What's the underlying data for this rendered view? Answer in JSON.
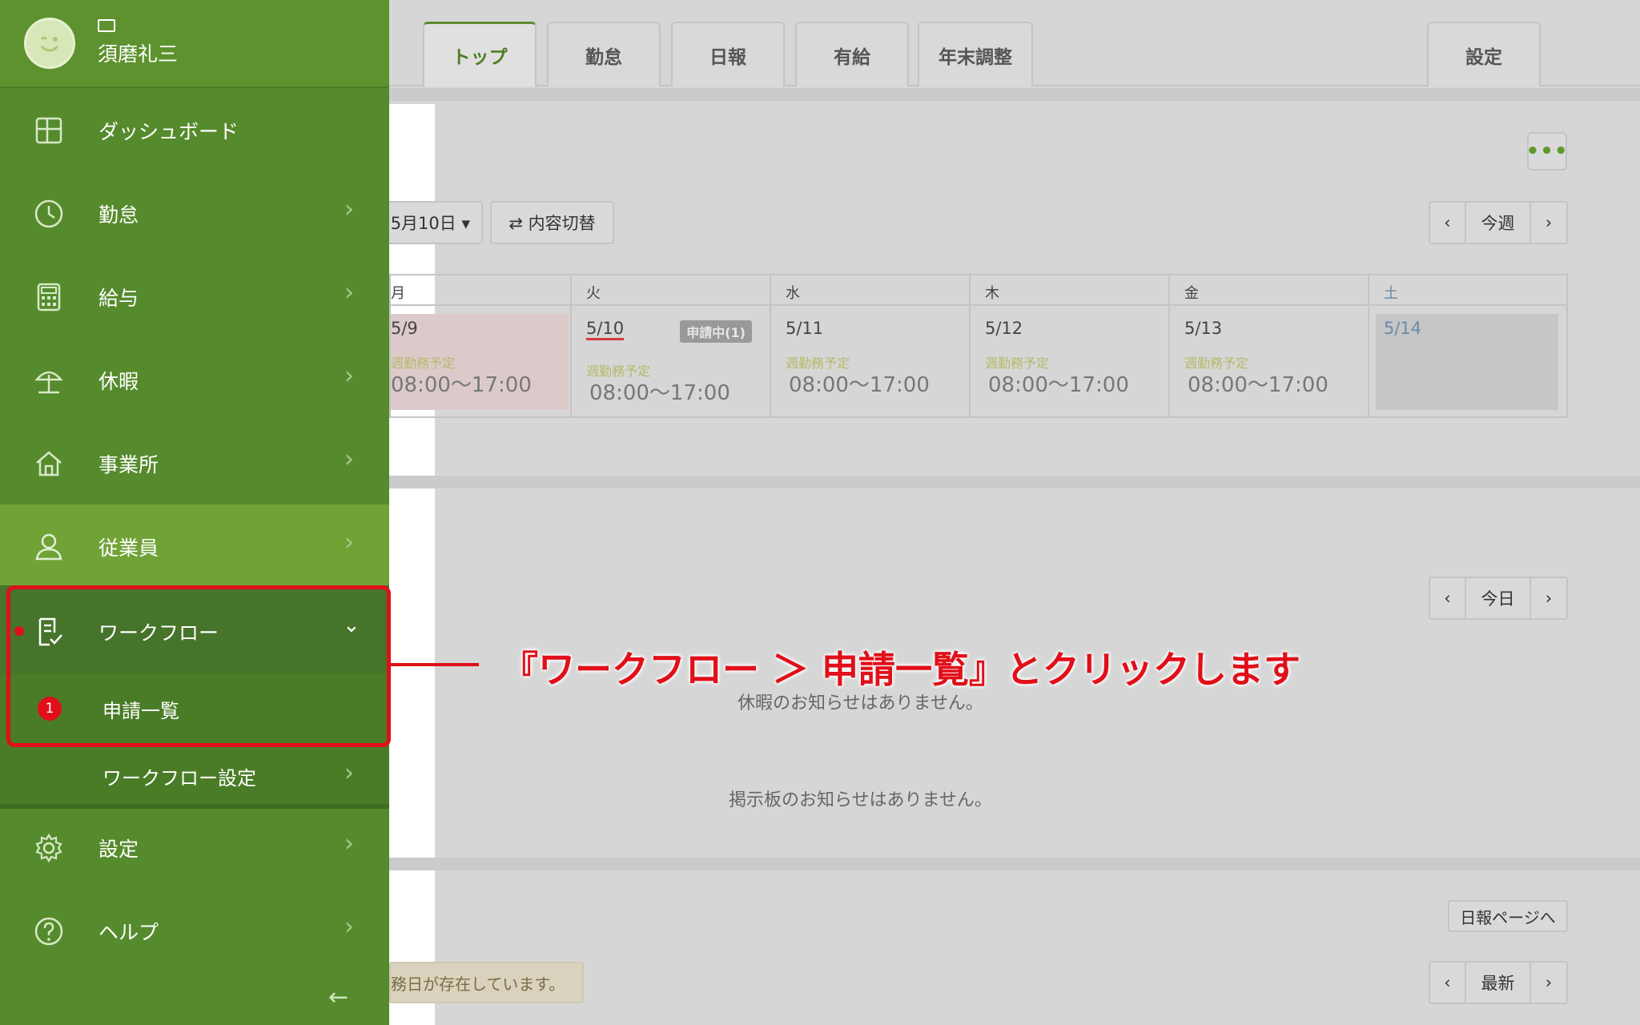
{
  "user": {
    "name": "須磨礼三"
  },
  "sidebar": {
    "items": [
      {
        "key": "dashboard",
        "label": "ダッシュボード"
      },
      {
        "key": "attendance",
        "label": "勤怠"
      },
      {
        "key": "salary",
        "label": "給与"
      },
      {
        "key": "leave",
        "label": "休暇"
      },
      {
        "key": "office",
        "label": "事業所"
      },
      {
        "key": "employee",
        "label": "従業員"
      },
      {
        "key": "workflow",
        "label": "ワークフロー"
      },
      {
        "key": "settings",
        "label": "設定"
      },
      {
        "key": "help",
        "label": "ヘルプ"
      }
    ],
    "workflow_sub": [
      {
        "label": "申請一覧",
        "badge": "1"
      },
      {
        "label": "ワークフロー設定"
      }
    ],
    "collapse": "←"
  },
  "tabs": [
    {
      "label": "トップ",
      "active": true
    },
    {
      "label": "勤怠"
    },
    {
      "label": "日報"
    },
    {
      "label": "有給"
    },
    {
      "label": "年末調整"
    },
    {
      "label": "設定"
    }
  ],
  "toolbar": {
    "more": "•••",
    "date_select": "5月10日 ▾",
    "switch_content": "⇄ 内容切替",
    "week_nav": {
      "prev": "‹",
      "label": "今週",
      "next": "›"
    }
  },
  "calendar": {
    "days": [
      {
        "head": "月",
        "date": "5/9",
        "plan": "週勤務予定",
        "time": "08:00～17:00"
      },
      {
        "head": "火",
        "date": "5/10",
        "plan": "週勤務予定",
        "time": "08:00～17:00",
        "badge": "申請中(1)"
      },
      {
        "head": "水",
        "date": "5/11",
        "plan": "週勤務予定",
        "time": "08:00～17:00"
      },
      {
        "head": "木",
        "date": "5/12",
        "plan": "週勤務予定",
        "time": "08:00～17:00"
      },
      {
        "head": "金",
        "date": "5/13",
        "plan": "週勤務予定",
        "time": "08:00～17:00"
      },
      {
        "head": "土",
        "date": "5/14"
      }
    ]
  },
  "leave_panel": {
    "nav": {
      "prev": "‹",
      "label": "今日",
      "next": "›"
    },
    "empty_leave": "休暇のお知らせはありません。",
    "empty_board": "掲示板のお知らせはありません。"
  },
  "report_panel": {
    "link": "日報ページへ",
    "nav": {
      "prev": "‹",
      "label": "最新",
      "next": "›"
    },
    "note": "務日が存在しています。"
  },
  "annotation": {
    "text": "『ワークフロー ＞ 申請一覧』とクリックします"
  },
  "colors": {
    "sidebar": "#568b2d",
    "accent": "#e10f19",
    "active_tab": "#4e7d22"
  }
}
